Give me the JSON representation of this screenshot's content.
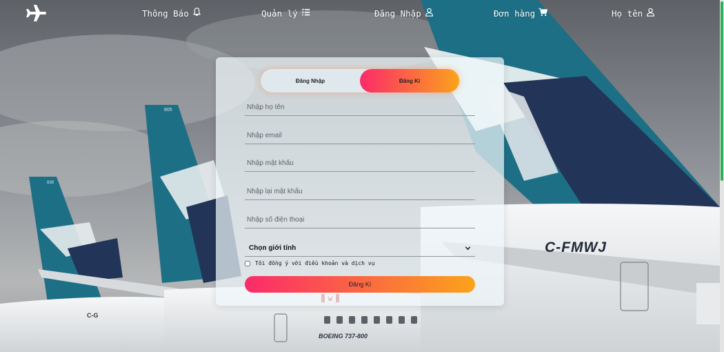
{
  "nav": {
    "logo_icon": "airplane-icon",
    "items": [
      {
        "label": "Thông Báo",
        "icon": "bell-icon"
      },
      {
        "label": "Quản lý",
        "icon": "list-check-icon"
      },
      {
        "label": "Đăng Nhập",
        "icon": "user-icon"
      },
      {
        "label": "Đơn hàng",
        "icon": "cart-icon"
      },
      {
        "label": "Họ tên",
        "icon": "user-icon"
      }
    ]
  },
  "auth": {
    "tabs": {
      "login": "Đăng Nhập",
      "register": "Đăng Kí"
    },
    "active_tab": "register",
    "fields": {
      "fullname_placeholder": "Nhập họ tên",
      "email_placeholder": "Nhập email",
      "password_placeholder": "Nhập mật khẩu",
      "confirm_password_placeholder": "Nhập lại mật khẩu",
      "phone_placeholder": "Nhập số điện thoại"
    },
    "gender_select": "Chọn giới tính",
    "agree_label": "Tôi đồng ý với điều khoản và dịch vụ",
    "agree_checked": false,
    "submit_label": "Đăng Kí"
  },
  "background": {
    "tail_codes": [
      "805",
      "838"
    ],
    "registrations": [
      "C-FMWJ",
      "C-G"
    ],
    "model_text": "BOEING 737-800"
  },
  "colors": {
    "gradient_start": "#fb2a6b",
    "gradient_end": "#fba31a",
    "tail_teal": "#1d6f86",
    "tail_navy": "#233459",
    "scrollbar_thumb": "#2fb157"
  }
}
